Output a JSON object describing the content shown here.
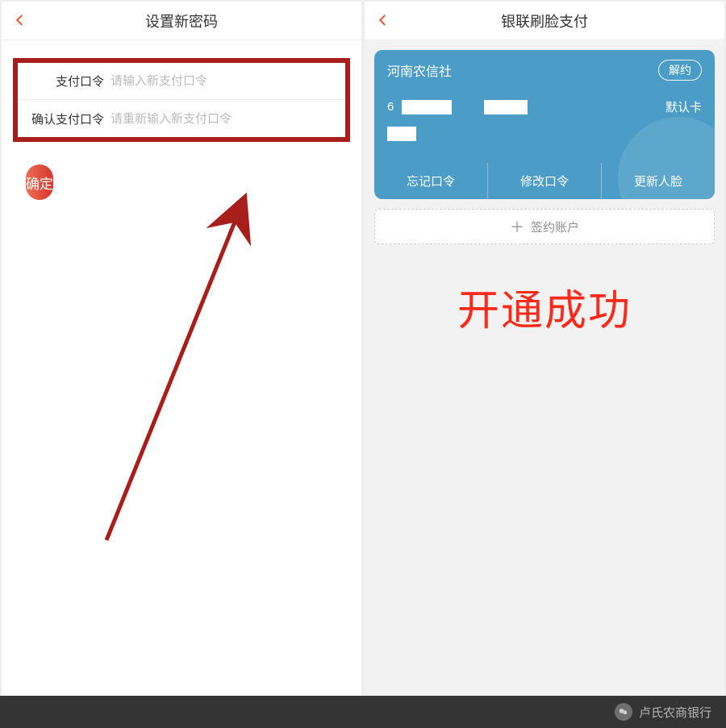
{
  "left": {
    "title": "设置新密码",
    "back_icon": "chevron-left",
    "form": {
      "password_label": "支付口令",
      "password_placeholder": "请输入新支付口令",
      "confirm_label": "确认支付口令",
      "confirm_placeholder": "请重新输入新支付口令"
    },
    "confirm_button": "确定"
  },
  "right": {
    "title": "银联刷脸支付",
    "card": {
      "bank_name": "河南农信社",
      "unsubscribe": "解约",
      "card_prefix": "6",
      "default_card_label": "默认卡",
      "actions": {
        "forgot": "忘记口令",
        "change": "修改口令",
        "update_face": "更新人脸"
      }
    },
    "sign_account": "签约账户",
    "success_text": "开通成功"
  },
  "footer": {
    "source": "卢氏农商银行"
  },
  "colors": {
    "accent": "#e84c2d",
    "highlight_border": "#a81e1a",
    "card_bg": "#4b9dc8",
    "success_red": "#ff2a1a"
  }
}
